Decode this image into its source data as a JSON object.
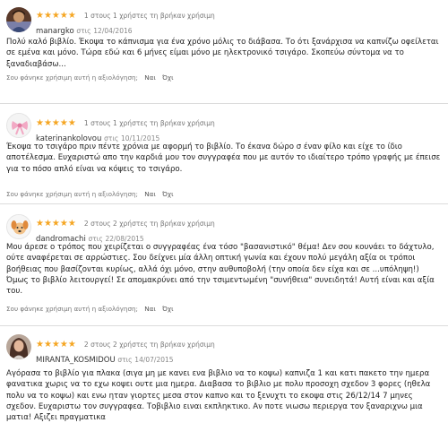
{
  "reviews": [
    {
      "stars": "★★★★★",
      "helpful": "1 στους 1 χρήστες τη βρήκαν χρήσιμη",
      "author": "manargko",
      "date_prefix": "στις",
      "date": "12/04/2016",
      "avatar_icon": "user-photo-avatar-icon",
      "body": "Πολύ καλό βιβλίο. Έκοψα το κάπνισμα για ένα χρόνο μόλις το διάβασα. Το ότι ξανάρχισα να καπνίζω οφείλεται σε εμένα και μόνο. Τώρα εδώ και 6 μήνες είμαι μόνο με ηλεκτρονικό τσιγάρο. Σκοπεύω σύντομα να το ξαναδιαβάσω...",
      "question": "Σου φάνηκε χρήσιμη αυτή η αξιολόγηση;",
      "yes": "Ναι",
      "no": "Όχι"
    },
    {
      "stars": "★★★★★",
      "helpful": "1 στους 1 χρήστες τη βρήκαν χρήσιμη",
      "author": "katerinankolovou",
      "date_prefix": "στις",
      "date": "10/11/2015",
      "avatar_icon": "bow-avatar-icon",
      "body": "Έκοψα το τσιγάρο πριν πέντε χρόνια με αφορμή το βιβλίο. Το έκανα δώρο σ έναν φίλο και είχε το ίδιο αποτέλεσμα. Ευχαριστώ απο την καρδιά μου τον συγγραφέα που με αυτόν το ιδιαίτερο τρόπο γραφής με έπεισε για το πόσο απλό είναι να κόψεις το τσιγάρο.",
      "question": "Σου φάνηκε χρήσιμη αυτή η αξιολόγηση;",
      "yes": "Ναι",
      "no": "Όχι"
    },
    {
      "stars": "★★★★★",
      "helpful": "2 στους 2 χρήστες τη βρήκαν χρήσιμη",
      "author": "dandromachi",
      "date_prefix": "στις",
      "date": "22/08/2015",
      "avatar_icon": "dog-avatar-icon",
      "body": "Μου άρεσε ο τρόπος που χειρίζεται ο συγγραφέας ένα τόσο \"βασανιστικό\" θέμα! Δεν σου κουνάει το δάχτυλο, ούτε αναφέρεται σε αρρώστιες. Σου δείχνει μία άλλη οπτική γωνία και έχουν πολύ μεγάλη αξία οι τρόποι βοήθειας που βασίζονται κυρίως, αλλά όχι μόνο, στην αυθυποβολή (την οποία δεν είχα και σε ...υπόληψη!) Όμως το βιβλίο λειτουργεί! Σε απομακρύνει από την τσιμεντωμένη \"συνήθεια\" συνειδητά! Αυτή είναι και αξία του.",
      "question": "Σου φάνηκε χρήσιμη αυτή η αξιολόγηση;",
      "yes": "Ναι",
      "no": "Όχι"
    },
    {
      "stars": "★★★★★",
      "helpful": "2 στους 2 χρήστες τη βρήκαν χρήσιμη",
      "author": "MIRANTA_KOSMIDOU",
      "date_prefix": "στις",
      "date": "14/07/2015",
      "avatar_icon": "woman-photo-avatar-icon",
      "body": "Αγόρασα το βιβλίο για πλακα (σιγα μη με κανει ενα βιβλιο να το κοψω) καπνιζα 1 και κατι πακετο την ημερα φανατικα χωρις να το εχω κοψει ουτε μια ημερα. Διαβασα το βιβλιο με πολυ προσοχη σχεδον 3 φορες (ηθελα πολυ να το κοψω) και ενω ηταν γιορτες μεσα στον καπνο και το ξενυχτι το εκοψα στις 26/12/14 7 μηνες σχεδον. Ευχαριστω τον συγγραφεα. Τοβιβλιο ειναι εκπληκτικο. Αν ποτε νιωσω περιεργα τον ξαναριχνω μια ματια! Αξιζει πραγματικα",
      "question": "",
      "yes": "",
      "no": ""
    }
  ]
}
